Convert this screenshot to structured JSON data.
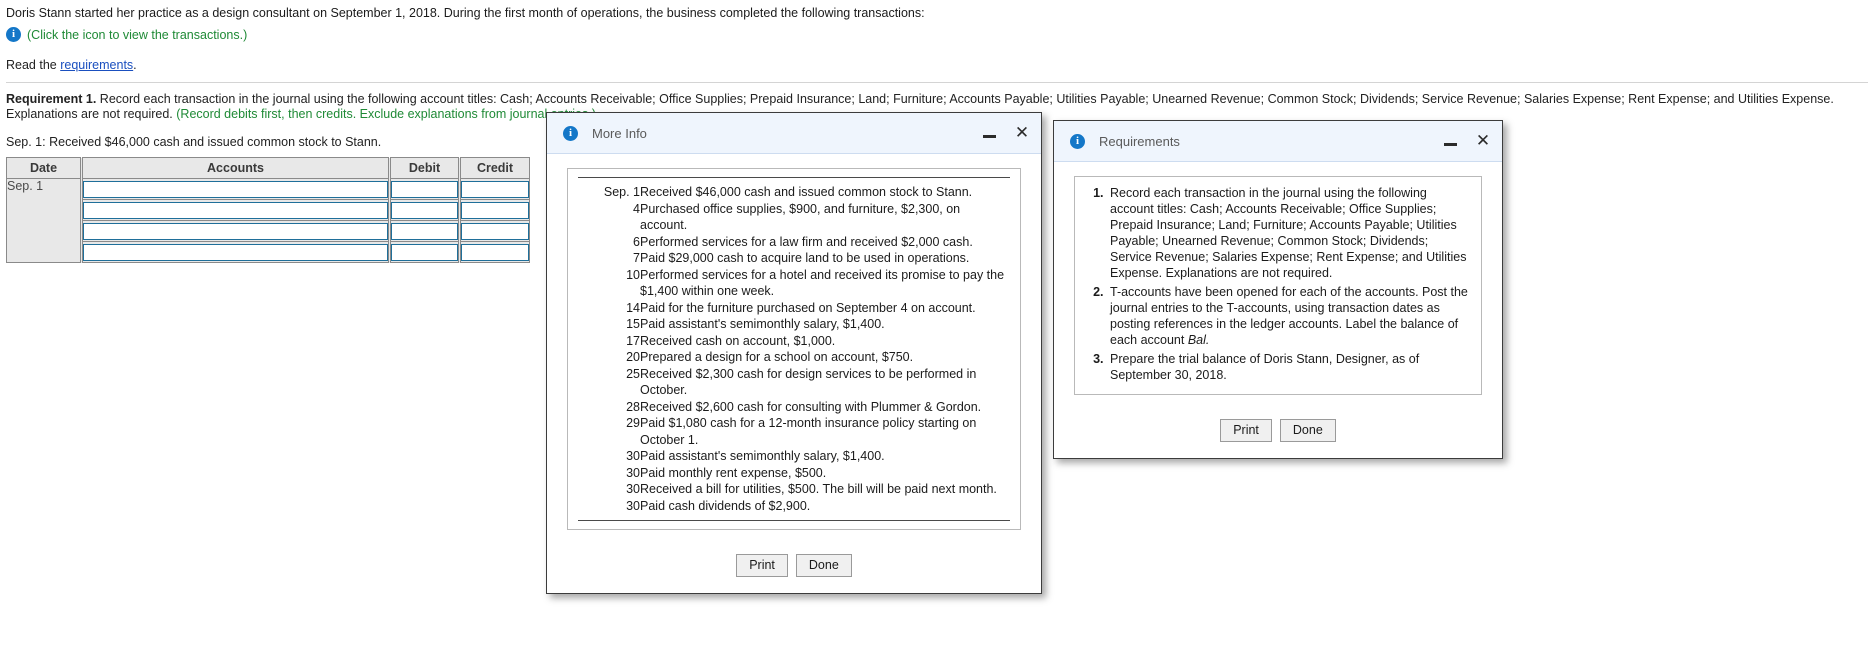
{
  "problem": {
    "intro": "Doris Stann started her practice as a design consultant on September 1, 2018. During the first month of operations, the business completed the following transactions:",
    "click_icon_text": "(Click the icon to view the transactions.)",
    "read_prefix": "Read the ",
    "read_link": "requirements",
    "read_suffix": ".",
    "requirement_label": "Requirement 1.",
    "requirement_text": " Record each transaction in the journal using the following account titles: Cash; Accounts Receivable; Office Supplies; Prepaid Insurance; Land; Furniture; Accounts Payable; Utilities Payable; Unearned Revenue; Common Stock; Dividends; Service Revenue; Salaries Expense; Rent Expense; and Utilities Expense. Explanations are not required. ",
    "requirement_hint": "(Record debits first, then credits. Exclude explanations from journal entries.)",
    "entry_prompt": "Sep. 1: Received $46,000 cash and issued common stock to Stann."
  },
  "journal": {
    "headers": [
      "Date",
      "Accounts",
      "Debit",
      "Credit"
    ],
    "date_value": "Sep. 1",
    "rows": [
      {
        "accounts": "",
        "debit": "",
        "credit": ""
      },
      {
        "accounts": "",
        "debit": "",
        "credit": ""
      },
      {
        "accounts": "",
        "debit": "",
        "credit": ""
      },
      {
        "accounts": "",
        "debit": "",
        "credit": ""
      }
    ]
  },
  "more_info_dialog": {
    "title": "More Info",
    "icon": "info-icon",
    "minimize_label": "minimize-icon",
    "close_label": "close-icon",
    "transactions": [
      {
        "date": "Sep. 1",
        "text": "Received $46,000 cash and issued common stock to Stann."
      },
      {
        "date": "4",
        "text": "Purchased office supplies, $900, and furniture, $2,300, on account."
      },
      {
        "date": "6",
        "text": "Performed services for a law firm and received $2,000 cash."
      },
      {
        "date": "7",
        "text": "Paid $29,000 cash to acquire land to be used in operations."
      },
      {
        "date": "10",
        "text": "Performed services for a hotel and received its promise to pay the $1,400 within one week."
      },
      {
        "date": "14",
        "text": "Paid for the furniture purchased on September 4 on account."
      },
      {
        "date": "15",
        "text": "Paid assistant's semimonthly salary, $1,400."
      },
      {
        "date": "17",
        "text": "Received cash on account, $1,000."
      },
      {
        "date": "20",
        "text": "Prepared a design for a school on account, $750."
      },
      {
        "date": "25",
        "text": "Received $2,300 cash for design services to be performed in October."
      },
      {
        "date": "28",
        "text": "Received $2,600 cash for consulting with Plummer & Gordon."
      },
      {
        "date": "29",
        "text": "Paid $1,080 cash for a 12-month insurance policy starting on October 1."
      },
      {
        "date": "30",
        "text": "Paid assistant's semimonthly salary, $1,400."
      },
      {
        "date": "30",
        "text": "Paid monthly rent expense, $500."
      },
      {
        "date": "30",
        "text": "Received a bill for utilities, $500. The bill will be paid next month."
      },
      {
        "date": "30",
        "text": "Paid cash dividends of $2,900."
      }
    ],
    "print_label": "Print",
    "done_label": "Done"
  },
  "requirements_dialog": {
    "title": "Requirements",
    "icon": "info-icon",
    "minimize_label": "minimize-icon",
    "close_label": "close-icon",
    "items": [
      "Record each transaction in the journal using the following account titles: Cash; Accounts Receivable; Office Supplies; Prepaid Insurance; Land; Furniture; Accounts Payable; Utilities Payable; Unearned Revenue; Common Stock; Dividends; Service Revenue; Salaries Expense; Rent Expense; and Utilities Expense. Explanations are not required.",
      "T-accounts have been opened for each of the accounts. Post the journal entries to the T-accounts, using transaction dates as posting references in the ledger accounts. Label the balance of each account Bal.",
      "Prepare the trial balance of Doris Stann, Designer, as of September 30, 2018."
    ],
    "item2_italic": "Bal.",
    "print_label": "Print",
    "done_label": "Done"
  },
  "colors": {
    "link": "#1a4fbf",
    "green": "#1f8a36",
    "info_blue": "#1477c8",
    "field_border": "#1f6f9a",
    "header_bg": "#e8e8e8"
  }
}
